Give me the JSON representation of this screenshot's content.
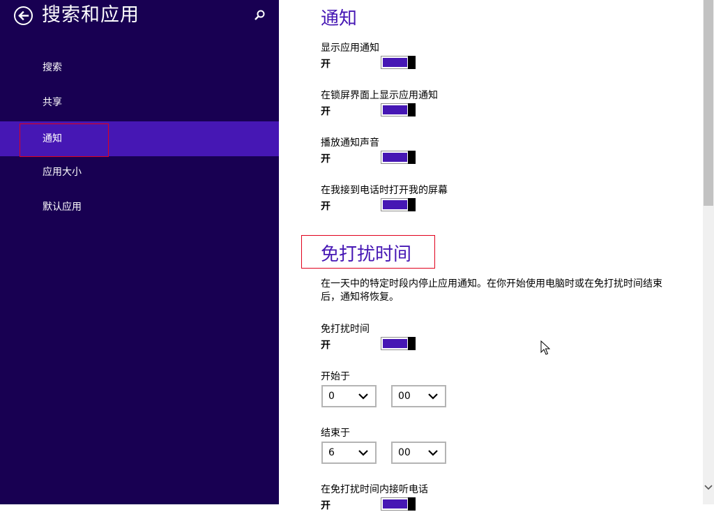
{
  "sidebar": {
    "title": "搜索和应用",
    "items": [
      {
        "label": "搜索"
      },
      {
        "label": "共享"
      },
      {
        "label": "通知"
      },
      {
        "label": "应用大小"
      },
      {
        "label": "默认应用"
      }
    ],
    "selected_index": 2
  },
  "notifications": {
    "heading": "通知",
    "settings": [
      {
        "label": "显示应用通知",
        "state": "开",
        "on": true
      },
      {
        "label": "在锁屏界面上显示应用通知",
        "state": "开",
        "on": true
      },
      {
        "label": "播放通知声音",
        "state": "开",
        "on": true
      },
      {
        "label": "在我接到电话时打开我的屏幕",
        "state": "开",
        "on": true
      }
    ]
  },
  "quiet_hours": {
    "heading": "免打扰时间",
    "description": "在一天中的特定时段内停止应用通知。在你开始使用电脑时或在免打扰时间结束后，通知将恢复。",
    "toggle": {
      "label": "免打扰时间",
      "state": "开",
      "on": true
    },
    "start": {
      "label": "开始于",
      "hour": "0",
      "minute": "00"
    },
    "end": {
      "label": "结束于",
      "hour": "6",
      "minute": "00"
    },
    "calls": {
      "label": "在免打扰时间内接听电话",
      "state": "开"
    }
  },
  "colors": {
    "sidebar_bg": "#180052",
    "accent": "#4617b4",
    "highlight_box": "#e0001b"
  }
}
